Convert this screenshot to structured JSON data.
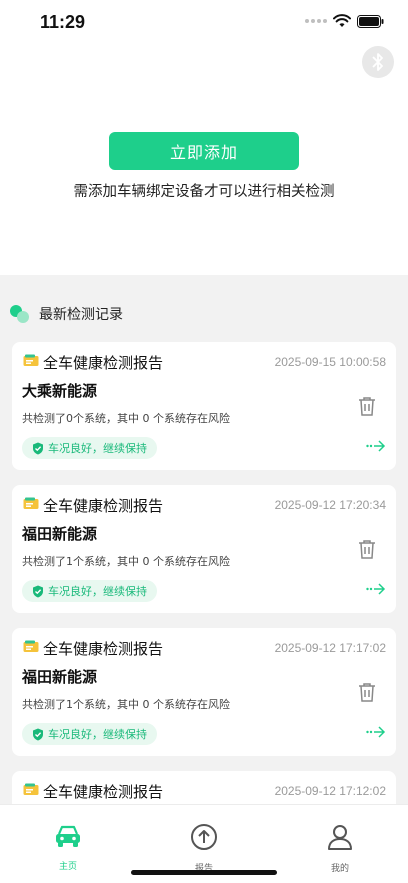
{
  "status_bar": {
    "time": "11:29"
  },
  "add_device": {
    "button_label": "立即添加",
    "hint": "需添加车辆绑定设备才可以进行相关检测"
  },
  "records": {
    "title": "最新检测记录",
    "items": [
      {
        "title": "全车健康检测报告",
        "date": "2025-09-15 10:00:58",
        "name": "大乘新能源",
        "summary": "共检测了0个系统，其中 0 个系统存在风险",
        "badge": "车况良好，继续保持"
      },
      {
        "title": "全车健康检测报告",
        "date": "2025-09-12 17:20:34",
        "name": "福田新能源",
        "summary": "共检测了1个系统，其中 0 个系统存在风险",
        "badge": "车况良好，继续保持"
      },
      {
        "title": "全车健康检测报告",
        "date": "2025-09-12 17:17:02",
        "name": "福田新能源",
        "summary": "共检测了1个系统，其中 0 个系统存在风险",
        "badge": "车况良好，继续保持"
      },
      {
        "title": "全车健康检测报告",
        "date": "2025-09-12 17:12:02"
      }
    ]
  },
  "tabs": [
    {
      "label": "主页",
      "icon": "car-icon",
      "active": true
    },
    {
      "label": "报告",
      "icon": "upload-circle-icon",
      "active": false
    },
    {
      "label": "我的",
      "icon": "person-icon",
      "active": false
    }
  ],
  "colors": {
    "accent": "#1ecf8b",
    "badge_bg": "#e8f8f0",
    "section_bg": "#f2f2f2"
  }
}
